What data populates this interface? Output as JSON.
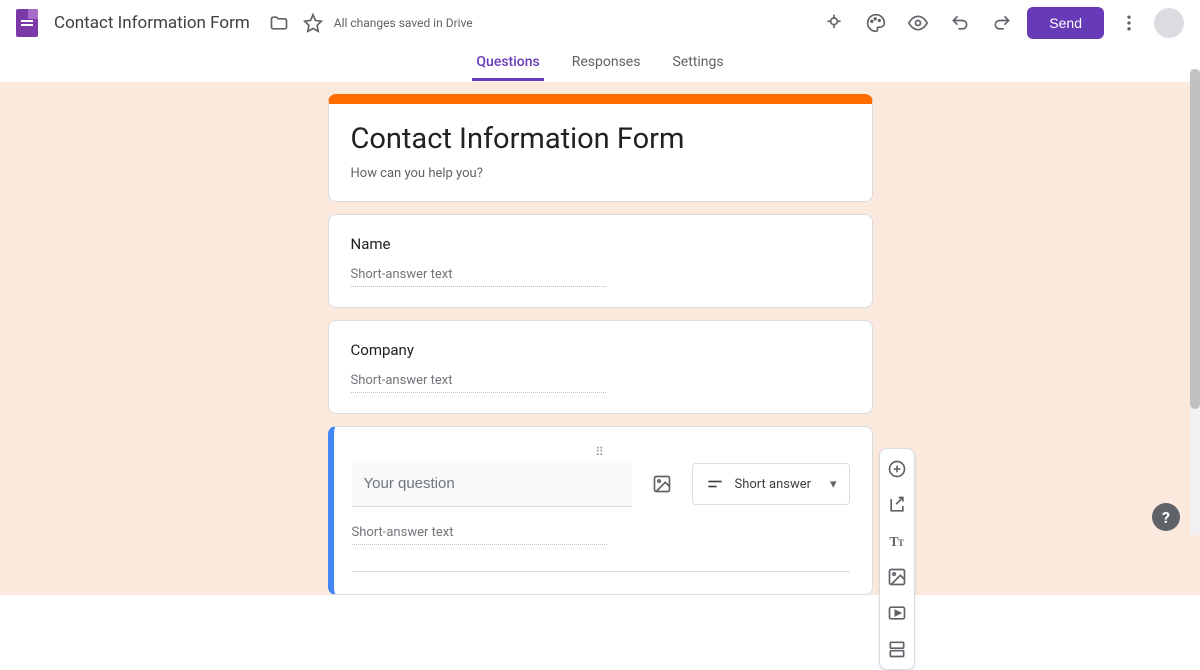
{
  "header": {
    "doc_title": "Contact Information Form",
    "save_status": "All changes saved in Drive",
    "send_label": "Send"
  },
  "tabs": {
    "questions": "Questions",
    "responses": "Responses",
    "settings": "Settings"
  },
  "form": {
    "title": "Contact Information Form",
    "description": "How can you help you?"
  },
  "questions": [
    {
      "label": "Name",
      "answer_ph": "Short-answer text"
    },
    {
      "label": "Company",
      "answer_ph": "Short-answer text"
    }
  ],
  "active_question": {
    "placeholder": "Your question",
    "type_label": "Short answer",
    "answer_ph": "Short-answer text"
  }
}
